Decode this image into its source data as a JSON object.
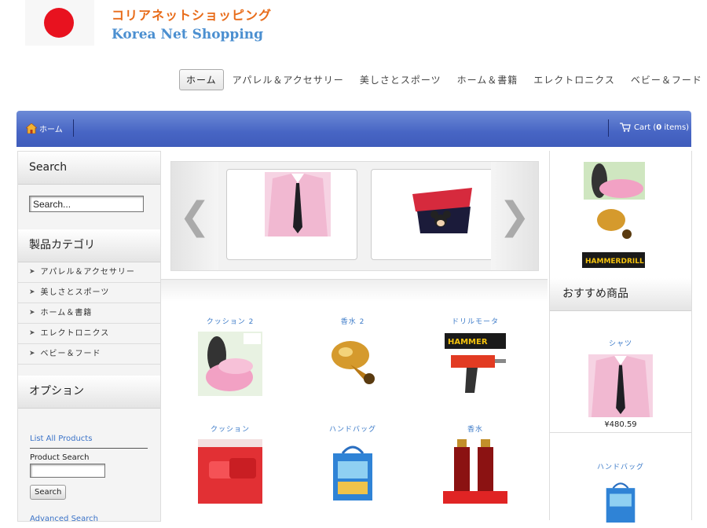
{
  "site": {
    "name_jp": "コリアネットショッピング",
    "name_en": "Korea Net Shopping"
  },
  "topnav": [
    {
      "label": "ホーム",
      "active": true
    },
    {
      "label": "アパレル＆アクセサリー"
    },
    {
      "label": "美しさとスポーツ"
    },
    {
      "label": "ホーム＆書籍"
    },
    {
      "label": "エレクトロニクス"
    },
    {
      "label": "ベビー＆フード"
    }
  ],
  "bar": {
    "home": "ホーム",
    "cart_prefix": "Cart (",
    "cart_count": "0",
    "cart_suffix": " items)"
  },
  "left": {
    "search_title": "Search",
    "search_placeholder": "Search...",
    "category_title": "製品カテゴリ",
    "categories": [
      "アパレル＆アクセサリー",
      "美しさとスポーツ",
      "ホーム＆書籍",
      "エレクトロニクス",
      "ベビー＆フード"
    ],
    "options_title": "オプション",
    "list_all": "List All Products",
    "product_search_label": "Product Search",
    "search_button": "Search",
    "advanced": "Advanced Search"
  },
  "products": [
    {
      "name": "クッション 2",
      "icon": "cushion-model"
    },
    {
      "name": "香水 2",
      "icon": "perfume-bottle"
    },
    {
      "name": "ドリルモータ",
      "icon": "power-drill"
    },
    {
      "name": "クッション",
      "icon": "red-cushion"
    },
    {
      "name": "ハンドバッグ",
      "icon": "handbag"
    },
    {
      "name": "香水",
      "icon": "perfume-box"
    }
  ],
  "right": {
    "recommended_title": "おすすめ商品",
    "featured": [
      {
        "name": "シャツ",
        "price": "¥480.59"
      },
      {
        "name": "ハンドバッグ",
        "price": ""
      }
    ]
  },
  "colors": {
    "accent_bar": "#4765c4",
    "link": "#3b7ac8",
    "logo_red": "#e8121f",
    "logo_orange": "#e86c1a"
  }
}
